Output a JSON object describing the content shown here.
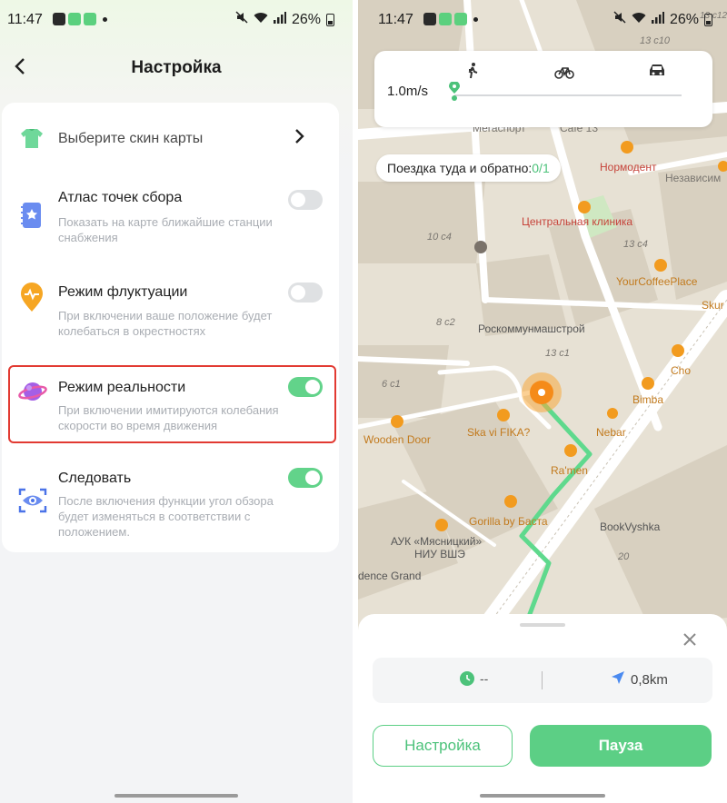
{
  "left": {
    "status": {
      "time": "11:47",
      "battery": "26%"
    },
    "header": {
      "back_icon": "chevron-left-icon",
      "title": "Настройка"
    },
    "items": [
      {
        "icon": "shirt-icon",
        "label": "Выберите скин карты",
        "control": "chevron"
      },
      {
        "icon": "book-icon",
        "label": "Атлас точек сбора",
        "desc": "Показать на карте ближайшие станции снабжения",
        "toggle": false
      },
      {
        "icon": "pulse-pin-icon",
        "label": "Режим флуктуации",
        "desc": "При включении ваше положение будет колебаться в окрестностях",
        "toggle": false
      },
      {
        "icon": "planet-icon",
        "label": "Режим реальности",
        "desc": "При включении имитируются колебания скорости во время движения",
        "toggle": true
      },
      {
        "icon": "eye-scan-icon",
        "label": "Следовать",
        "desc": "После включения функции угол обзора будет изменяться в соответствии с положением.",
        "toggle": true
      }
    ]
  },
  "right": {
    "status": {
      "time": "11:47",
      "battery": "26%"
    },
    "speed": {
      "value": "1.0m/s",
      "modes": [
        "walk-icon",
        "bike-icon",
        "car-icon"
      ],
      "slider_level": 0
    },
    "trip": {
      "label": "Поездка туда и обратно:",
      "count": "0/1"
    },
    "map_labels": {
      "l1": "13 с10",
      "l2": "Мегаспорт",
      "l3": "Cafe 13",
      "l4": "Нормодент",
      "l5": "Независим",
      "l6": "Центральная клиника",
      "l7": "10 с4",
      "l8": "13 с4",
      "l9": "YourCoffeePlace",
      "l10": "8 с2",
      "l11": "Роскоммунмашстрой",
      "l12": "Skur",
      "l13": "13 с1",
      "l14": "Cho",
      "l15": "6 с1",
      "l16": "Bimba",
      "l17": "Ska vi FIKA?",
      "l18": "Nebar",
      "l19": "Wooden Door",
      "l20": "Ra'men",
      "l21": "Gorilla by Баста",
      "l22": "BookVyshka",
      "l23": "АУК «Мясницкий»",
      "l24": "НИУ ВШЭ",
      "l25": "dence Grand",
      "l26": "20",
      "l27": "13 с12"
    },
    "sheet": {
      "close_icon": "close-icon",
      "time_value": "--",
      "distance_value": "0,8km",
      "settings_button": "Настройка",
      "pause_button": "Пауза"
    },
    "colors": {
      "accent": "#5ccf85",
      "highlight": "#e23a32"
    }
  }
}
